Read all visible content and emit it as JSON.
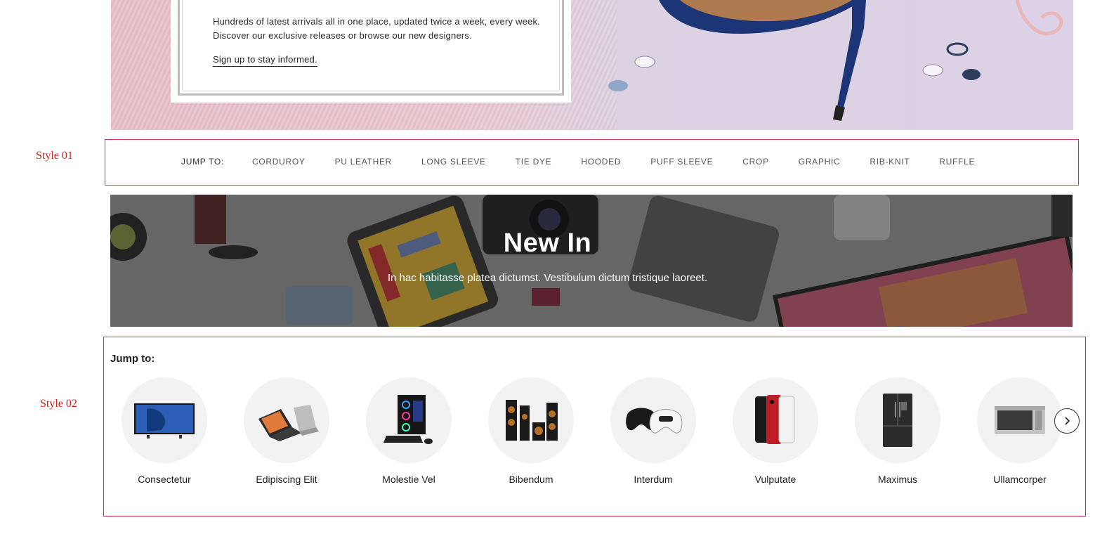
{
  "hero": {
    "text": "Hundreds of latest arrivals all in one place, updated twice a week, every week. Discover our exclusive releases or browse our new designers.",
    "link": "Sign up to stay informed."
  },
  "labels": {
    "style01": "Style 01",
    "style02": "Style 02"
  },
  "style01": {
    "jump_label": "JUMP TO:",
    "items": [
      "CORDUROY",
      "PU LEATHER",
      "LONG SLEEVE",
      "TIE DYE",
      "HOODED",
      "PUFF SLEEVE",
      "CROP",
      "GRAPHIC",
      "RIB-KNIT",
      "RUFFLE"
    ]
  },
  "banner": {
    "title": "New In",
    "subtitle": "In hac habitasse platea dictumst. Vestibulum dictum tristique laoreet."
  },
  "style02": {
    "title": "Jump to:",
    "categories": [
      {
        "label": "Consectetur",
        "icon": "tv-icon"
      },
      {
        "label": "Edipiscing Elit",
        "icon": "laptop-icon"
      },
      {
        "label": "Molestie Vel",
        "icon": "desktop-pc-icon"
      },
      {
        "label": "Bibendum",
        "icon": "speakers-icon"
      },
      {
        "label": "Interdum",
        "icon": "game-controller-icon"
      },
      {
        "label": "Vulputate",
        "icon": "smartphone-icon"
      },
      {
        "label": "Maximus",
        "icon": "refrigerator-icon"
      },
      {
        "label": "Ullamcorper",
        "icon": "microwave-icon"
      }
    ],
    "next_icon": "chevron-right-icon"
  },
  "colors": {
    "accent_border": "#cc3344",
    "label_red": "#d0211b",
    "circle_bg": "#f2f2f2"
  }
}
